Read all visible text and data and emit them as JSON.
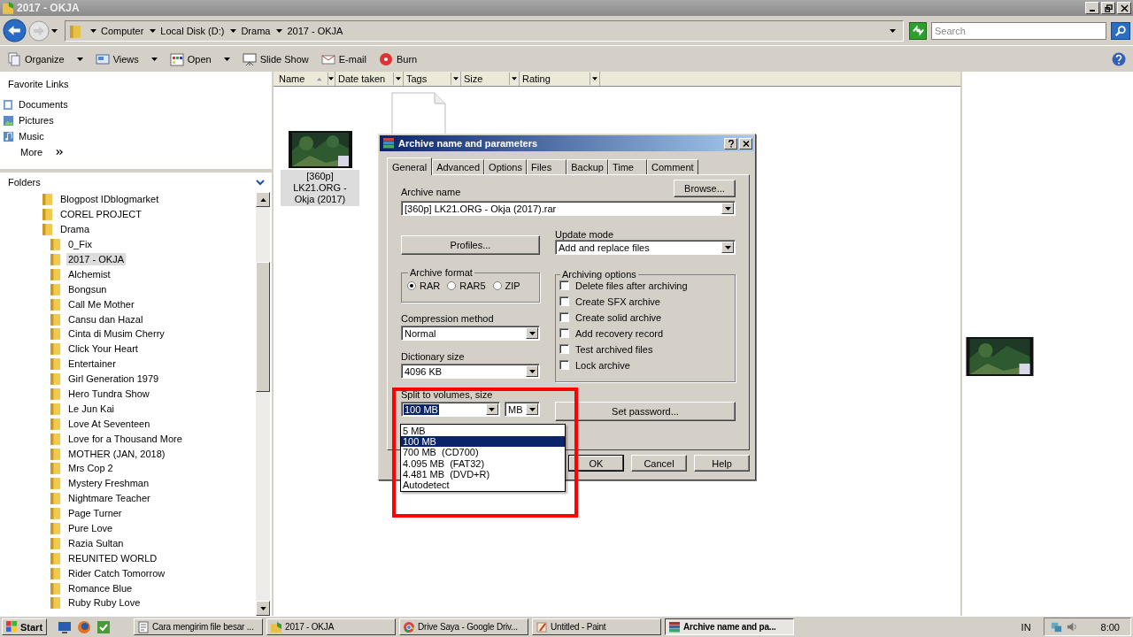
{
  "window": {
    "title": "2017 - OKJA"
  },
  "address": {
    "breadcrumbs": [
      "Computer",
      "Local Disk (D:)",
      "Drama",
      "2017 - OKJA"
    ],
    "search_placeholder": "Search"
  },
  "toolbar": [
    {
      "label": "Organize",
      "kind": "organize",
      "menu": true
    },
    {
      "label": "Views",
      "kind": "views",
      "menu": true
    },
    {
      "label": "Open",
      "kind": "open",
      "menu": true
    },
    {
      "label": "Slide Show",
      "kind": "slideshow",
      "menu": false
    },
    {
      "label": "E-mail",
      "kind": "email",
      "menu": false
    },
    {
      "label": "Burn",
      "kind": "burn",
      "menu": false
    }
  ],
  "favorite_links": {
    "title": "Favorite Links",
    "items": [
      {
        "label": "Documents",
        "kind": "documents"
      },
      {
        "label": "Pictures",
        "kind": "pictures"
      },
      {
        "label": "Music",
        "kind": "music"
      }
    ],
    "more": "More"
  },
  "folders": {
    "title": "Folders",
    "items": [
      {
        "label": "Blogpost IDblogmarket",
        "selected": false
      },
      {
        "label": "COREL PROJECT",
        "selected": false
      },
      {
        "label": "Drama",
        "selected": false,
        "children": [
          {
            "label": "0_Fix",
            "selected": false
          },
          {
            "label": "2017 - OKJA",
            "selected": true
          },
          {
            "label": "Alchemist",
            "selected": false
          },
          {
            "label": "Bongsun",
            "selected": false
          },
          {
            "label": "Call Me Mother",
            "selected": false
          },
          {
            "label": "Cansu dan Hazal",
            "selected": false
          },
          {
            "label": "Cinta di Musim Cherry",
            "selected": false
          },
          {
            "label": "Click Your Heart",
            "selected": false
          },
          {
            "label": "Entertainer",
            "selected": false
          },
          {
            "label": "Girl Generation 1979",
            "selected": false
          },
          {
            "label": "Hero Tundra Show",
            "selected": false
          },
          {
            "label": "Le Jun Kai",
            "selected": false
          },
          {
            "label": "Love At Seventeen",
            "selected": false
          },
          {
            "label": "Love for a Thousand More",
            "selected": false
          },
          {
            "label": "MOTHER (JAN, 2018)",
            "selected": false
          },
          {
            "label": "Mrs Cop 2",
            "selected": false
          },
          {
            "label": "Mystery Freshman",
            "selected": false
          },
          {
            "label": "Nightmare Teacher",
            "selected": false
          },
          {
            "label": "Page Turner",
            "selected": false
          },
          {
            "label": "Pure Love",
            "selected": false
          },
          {
            "label": "Razia Sultan",
            "selected": false
          },
          {
            "label": "REUNITED WORLD",
            "selected": false
          },
          {
            "label": "Rider Catch Tomorrow",
            "selected": false
          },
          {
            "label": "Romance Blue",
            "selected": false
          },
          {
            "label": "Ruby Ruby Love",
            "selected": false
          }
        ]
      }
    ]
  },
  "columns": [
    {
      "label": "Name",
      "sorted": true
    },
    {
      "label": "Date taken",
      "sorted": false
    },
    {
      "label": "Tags",
      "sorted": false
    },
    {
      "label": "Size",
      "sorted": false
    },
    {
      "label": "Rating",
      "sorted": false
    }
  ],
  "files": [
    {
      "kind": "video",
      "name": "[360p] LK21.ORG - Okja (2017)",
      "selected": true
    },
    {
      "kind": "document",
      "selected": false
    }
  ],
  "dialog": {
    "title": "Archive name and parameters",
    "tabs": [
      {
        "label": "General",
        "selected": true
      },
      {
        "label": "Advanced",
        "selected": false
      },
      {
        "label": "Options",
        "selected": false
      },
      {
        "label": "Files",
        "selected": false
      },
      {
        "label": "Backup",
        "selected": false
      },
      {
        "label": "Time",
        "selected": false
      },
      {
        "label": "Comment",
        "selected": false
      }
    ],
    "archive_name_label": "Archive name",
    "archive_name": "[360p] LK21.ORG - Okja (2017).rar",
    "browse": "Browse...",
    "profiles": "Profiles...",
    "update_mode_label": "Update mode",
    "update_mode": "Add and replace files",
    "format_label": "Archive format",
    "formats": [
      {
        "label": "RAR",
        "selected": true
      },
      {
        "label": "RAR5",
        "selected": false
      },
      {
        "label": "ZIP",
        "selected": false
      }
    ],
    "compression_label": "Compression method",
    "compression": "Normal",
    "dictionary_label": "Dictionary size",
    "dictionary": "4096 KB",
    "split_label": "Split to volumes, size",
    "split": "100 MB",
    "split_unit": "MB",
    "options_label": "Archiving options",
    "options": [
      {
        "label": "Delete files after archiving",
        "checked": false
      },
      {
        "label": "Create SFX archive",
        "checked": false
      },
      {
        "label": "Create solid archive",
        "checked": false
      },
      {
        "label": "Add recovery record",
        "checked": false
      },
      {
        "label": "Test archived files",
        "checked": false
      },
      {
        "label": "Lock archive",
        "checked": false
      }
    ],
    "set_password": "Set password...",
    "buttons": [
      "OK",
      "Cancel",
      "Help"
    ],
    "split_options": [
      {
        "label": "5 MB",
        "selected": false
      },
      {
        "label": "100 MB",
        "selected": true
      },
      {
        "label": "700 MB  (CD700)",
        "selected": false
      },
      {
        "label": "4.095 MB  (FAT32)",
        "selected": false
      },
      {
        "label": "4.481 MB  (DVD+R)",
        "selected": false
      },
      {
        "label": "Autodetect",
        "selected": false
      }
    ]
  },
  "taskbar": {
    "start": "Start",
    "tasks": [
      {
        "label": "Cara mengirim file besar ...",
        "kind": "document",
        "selected": false
      },
      {
        "label": "2017 - OKJA",
        "kind": "folder",
        "selected": false
      },
      {
        "label": "Drive Saya - Google Driv...",
        "kind": "browser",
        "selected": false
      },
      {
        "label": "Untitled - Paint",
        "kind": "paint",
        "selected": false
      },
      {
        "label": "Archive name and pa...",
        "kind": "archive",
        "selected": true
      }
    ],
    "language": "IN",
    "clock": "8:00"
  }
}
